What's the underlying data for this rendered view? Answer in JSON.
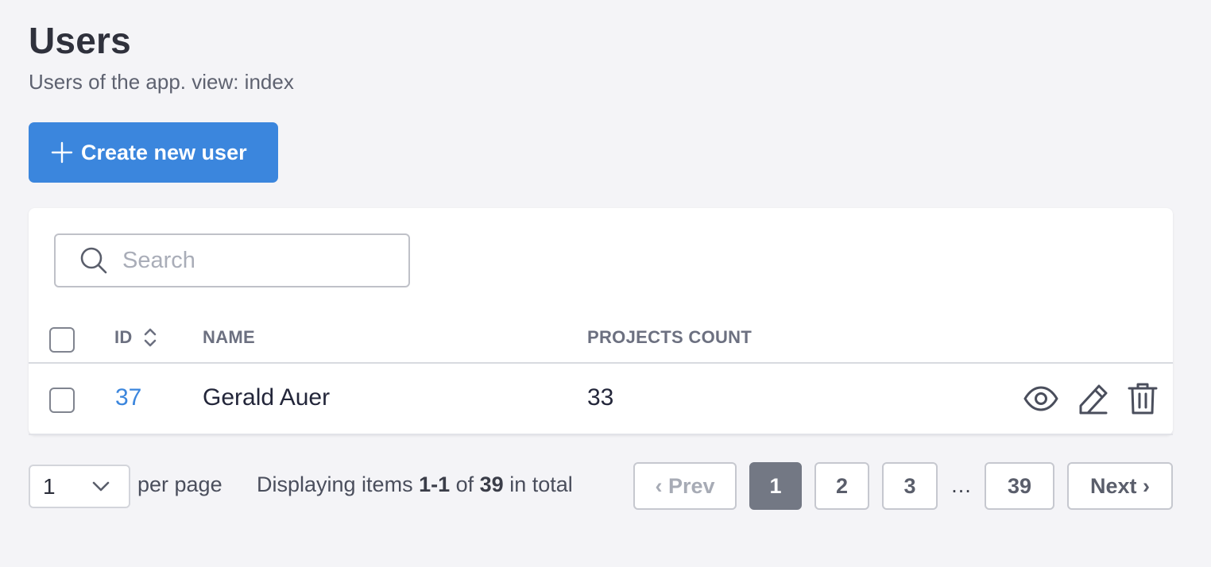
{
  "header": {
    "title": "Users",
    "subtitle": "Users of the app. view: index"
  },
  "create_button": {
    "label": "Create new user",
    "icon": "plus-icon"
  },
  "search": {
    "placeholder": "Search",
    "value": ""
  },
  "table": {
    "columns": [
      "ID",
      "NAME",
      "PROJECTS COUNT"
    ],
    "sortable_column_icon": "sort-icon",
    "rows": [
      {
        "id": "37",
        "name": "Gerald Auer",
        "projects_count": "33"
      }
    ],
    "row_action_icons": [
      "eye-icon",
      "pencil-icon",
      "trash-icon"
    ]
  },
  "pagination": {
    "per_page_value": "1",
    "per_page_label": "per page",
    "display_prefix": "Displaying items ",
    "display_range": "1-1",
    "display_of": " of ",
    "display_total": "39",
    "display_suffix": " in total",
    "prev_label": "‹ Prev",
    "next_label": "Next ›",
    "pages": [
      "1",
      "2",
      "3"
    ],
    "ellipsis": "…",
    "last_page": "39",
    "current_page": "1"
  },
  "colors": {
    "accent": "#3b86dd",
    "background": "#f4f4f7",
    "active_page": "#737884"
  }
}
